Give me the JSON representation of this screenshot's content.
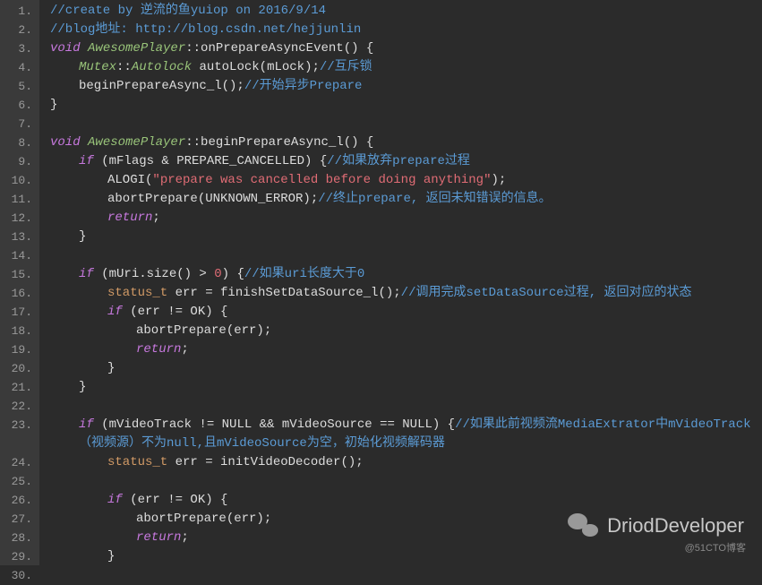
{
  "lines": {
    "l1_comment": "//create by 逆流的鱼yuiop on 2016/9/14",
    "l2_comment": "//blog地址: http://blog.csdn.net/hejjunlin",
    "l3_void": "void",
    "l3_class": "AwesomePlayer",
    "l3_method": "onPrepareAsyncEvent",
    "l4_mutex": "Mutex",
    "l4_autolock": "Autolock",
    "l4_var": "autoLock(mLock);",
    "l4_comment": "//互斥锁",
    "l5_call": "beginPrepareAsync_l();",
    "l5_comment": "//开始异步Prepare",
    "l8_void": "void",
    "l8_class": "AwesomePlayer",
    "l8_method": "beginPrepareAsync_l",
    "l9_if": "if",
    "l9_cond": "(mFlags & PREPARE_CANCELLED) {",
    "l9_comment": "//如果放弃prepare过程",
    "l10_alogi": "ALOGI(",
    "l10_string": "\"prepare was cancelled before doing anything\"",
    "l10_end": ");",
    "l11_call": "abortPrepare(UNKNOWN_ERROR);",
    "l11_comment": "//终止prepare, 返回未知错误的信息。",
    "l12_return": "return",
    "l15_if": "if",
    "l15_cond": "(mUri.size() > ",
    "l15_zero": "0",
    "l15_close": ") {",
    "l15_comment": "//如果uri长度大于0",
    "l16_type": "status_t",
    "l16_rest": " err = finishSetDataSource_l();",
    "l16_comment": "//调用完成setDataSource过程, 返回对应的状态",
    "l17_if": "if",
    "l17_cond": " (err != OK) {",
    "l18_call": "abortPrepare(err);",
    "l19_return": "return",
    "l23_if": "if",
    "l23_cond": " (mVideoTrack != NULL && mVideoSource == NULL) {",
    "l23_comment": "//如果此前视频流MediaExtrator中mVideoTrack（视频源）不为null,且mVideoSource为空，初始化视频解码器",
    "l24_type": "status_t",
    "l24_rest": " err = initVideoDecoder();",
    "l26_if": "if",
    "l26_cond": " (err != OK) {",
    "l27_call": "abortPrepare(err);",
    "l28_return": "return"
  },
  "watermark1": "DriodDeveloper",
  "watermark2": "@51CTO博客"
}
